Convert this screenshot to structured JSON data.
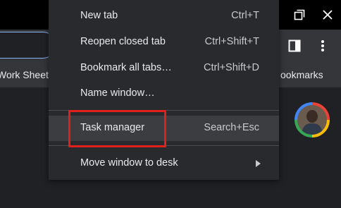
{
  "bookmarks_bar": {
    "left_item": "Work Sheets",
    "right_item": "ookmarks"
  },
  "menu": {
    "new_tab": {
      "label": "New tab",
      "shortcut": "Ctrl+T"
    },
    "reopen_closed_tab": {
      "label": "Reopen closed tab",
      "shortcut": "Ctrl+Shift+T"
    },
    "bookmark_all_tabs": {
      "label": "Bookmark all tabs…",
      "shortcut": "Ctrl+Shift+D"
    },
    "name_window": {
      "label": "Name window…"
    },
    "task_manager": {
      "label": "Task manager",
      "shortcut": "Search+Esc"
    },
    "move_window_to_desk": {
      "label": "Move window to desk"
    }
  },
  "icons": {
    "restore": "restore-window-icon",
    "close": "close-icon",
    "side_panel": "side-panel-icon",
    "more": "more-vert-icon",
    "submenu": "chevron-right-icon"
  },
  "colors": {
    "highlight_box": "#e0201b",
    "focus_ring": "#8ab4f8"
  }
}
